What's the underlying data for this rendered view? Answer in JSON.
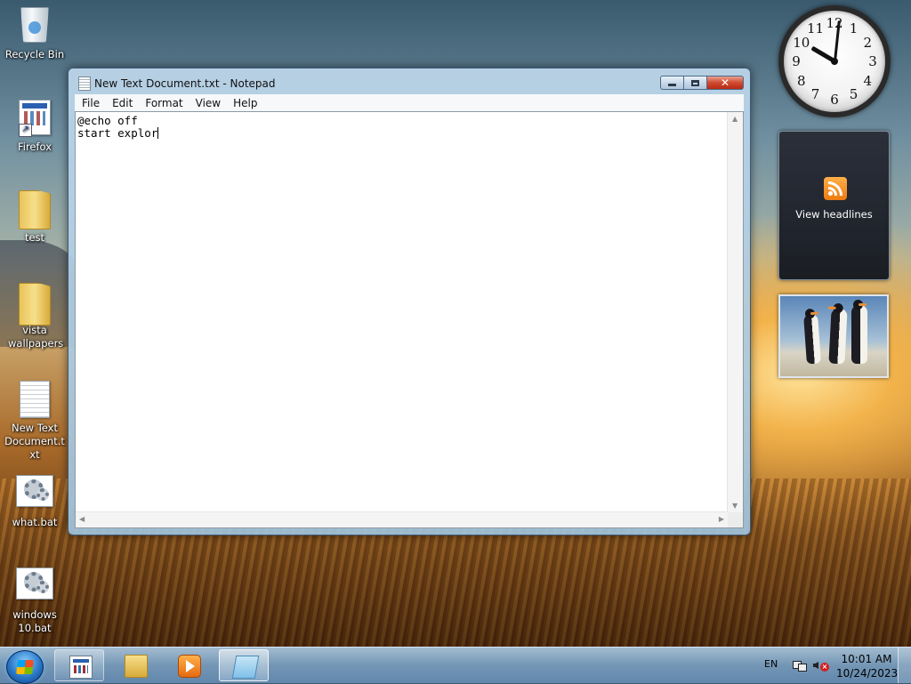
{
  "desktop": {
    "icons": [
      {
        "label": "Recycle Bin",
        "icon": "recycle-bin-icon"
      },
      {
        "label": "Firefox",
        "icon": "shortcut-app-icon"
      },
      {
        "label": "test",
        "icon": "folder-icon"
      },
      {
        "label": "vista wallpapers",
        "icon": "folder-icon"
      },
      {
        "label": "New Text Document.txt",
        "icon": "text-file-icon"
      },
      {
        "label": "what.bat",
        "icon": "batch-file-icon"
      },
      {
        "label": "windows 10.bat",
        "icon": "batch-file-icon"
      }
    ]
  },
  "notepad": {
    "title": "New Text Document.txt - Notepad",
    "menu": [
      "File",
      "Edit",
      "Format",
      "View",
      "Help"
    ],
    "content_lines": [
      "@echo off",
      "start explor"
    ]
  },
  "gadgets": {
    "clock": {
      "numerals": [
        "12",
        "1",
        "2",
        "3",
        "4",
        "5",
        "6",
        "7",
        "8",
        "9",
        "10",
        "11"
      ],
      "hour": 10,
      "minute": 1
    },
    "feed": {
      "label": "View headlines",
      "icon": "rss-icon"
    },
    "slideshow": {
      "subject": "penguins"
    }
  },
  "taskbar": {
    "apps": [
      {
        "name": "shortcut-app",
        "state": "open"
      },
      {
        "name": "windows-explorer",
        "state": "pinned"
      },
      {
        "name": "media-player",
        "state": "pinned"
      },
      {
        "name": "notepad",
        "state": "active"
      }
    ],
    "tray": {
      "language": "EN",
      "time": "10:01 AM",
      "date": "10/24/2023"
    }
  }
}
